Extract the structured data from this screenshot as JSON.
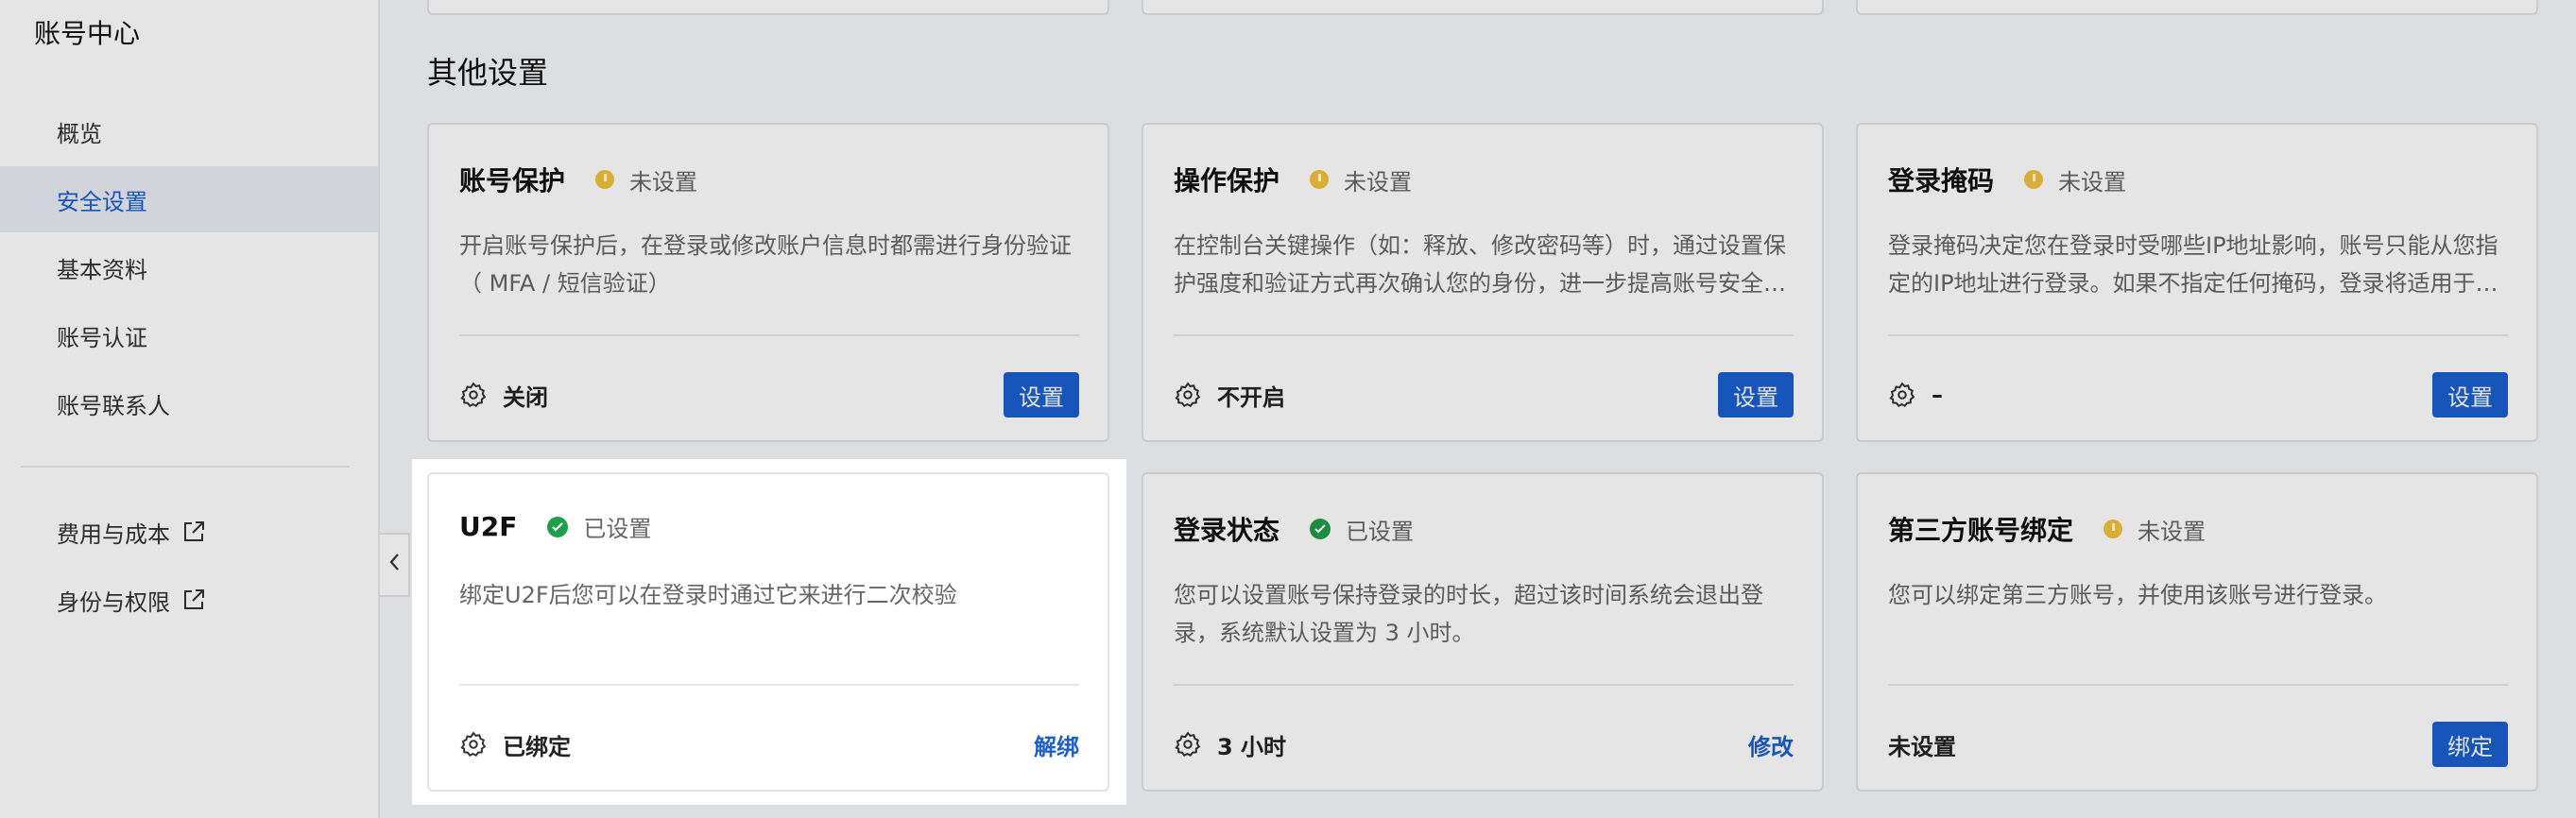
{
  "sidebar": {
    "title": "账号中心",
    "items": [
      {
        "label": "概览"
      },
      {
        "label": "安全设置"
      },
      {
        "label": "基本资料"
      },
      {
        "label": "账号认证"
      },
      {
        "label": "账号联系人"
      }
    ],
    "external_items": [
      {
        "label": "费用与成本",
        "icon": "external-link-icon"
      },
      {
        "label": "身份与权限",
        "icon": "external-link-icon"
      }
    ]
  },
  "main": {
    "section_title": "其他设置",
    "cards": [
      {
        "title": "账号保护",
        "status": "未设置",
        "status_type": "warning",
        "description": "开启账号保护后，在登录或修改账户信息时都需进行身份验证（ MFA / 短信验证）",
        "value": "关闭",
        "action": "设置",
        "action_style": "button"
      },
      {
        "title": "操作保护",
        "status": "未设置",
        "status_type": "warning",
        "description": "在控制台关键操作（如：释放、修改密码等）时，通过设置保护强度和验证方式再次确认您的身份，进一步提高账号安全…",
        "value": "不开启",
        "action": "设置",
        "action_style": "button"
      },
      {
        "title": "登录掩码",
        "status": "未设置",
        "status_type": "warning",
        "description": "登录掩码决定您在登录时受哪些IP地址影响，账号只能从您指定的IP地址进行登录。如果不指定任何掩码，登录将适用于…",
        "value": "–",
        "action": "设置",
        "action_style": "button"
      },
      {
        "title": "U2F",
        "status": "已设置",
        "status_type": "ok",
        "description": "绑定U2F后您可以在登录时通过它来进行二次校验",
        "value": "已绑定",
        "action": "解绑",
        "action_style": "link"
      },
      {
        "title": "登录状态",
        "status": "已设置",
        "status_type": "ok",
        "description": "您可以设置账号保持登录的时长，超过该时间系统会退出登录，系统默认设置为 3 小时。",
        "value": "3 小时",
        "action": "修改",
        "action_style": "link"
      },
      {
        "title": "第三方账号绑定",
        "status": "未设置",
        "status_type": "warning",
        "description": "您可以绑定第三方账号，并使用该账号进行登录。",
        "value": "未设置",
        "action": "绑定",
        "action_style": "button"
      }
    ]
  },
  "colors": {
    "accent": "#1b5fd1",
    "warning": "#f2c23a",
    "ok": "#1e9e4a"
  }
}
